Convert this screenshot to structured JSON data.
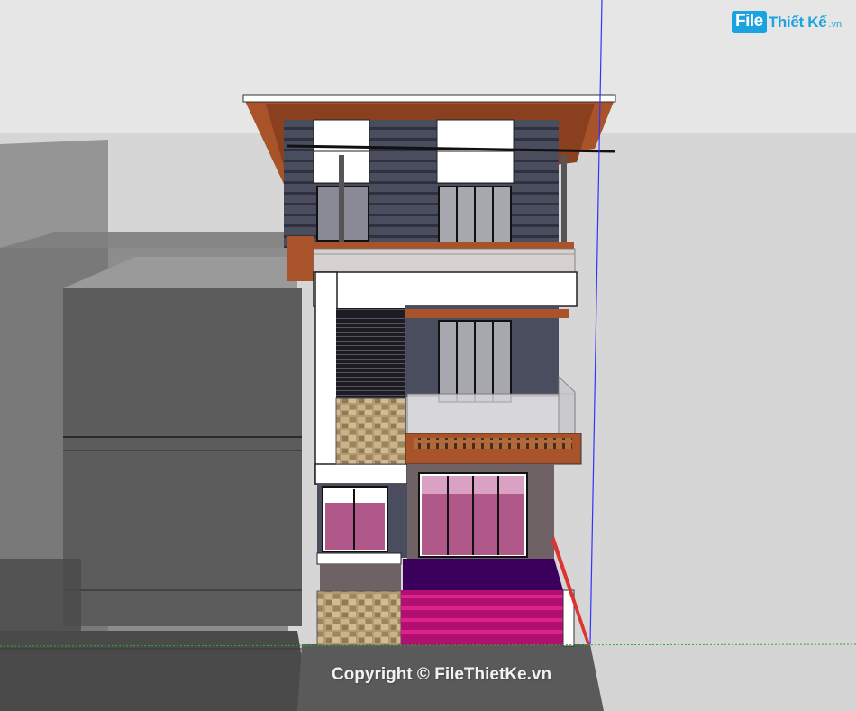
{
  "logo": {
    "badge": "File",
    "text": "Thiết Kế",
    "suffix": ".vn"
  },
  "watermark": {
    "text": "Copyright © FileThietKe.vn"
  },
  "colors": {
    "sky": "#e6e6e6",
    "ground": "#d6d6d6",
    "wall_dark": "#4a4d5e",
    "wood": "#a8532a",
    "pink_glass": "#b0588a",
    "stair_pink": "#e0208f",
    "stone": "#b39a70",
    "white": "#ffffff",
    "axis_blue": "#3333ff",
    "axis_green": "#33aa33",
    "axis_red": "#dd3333"
  }
}
